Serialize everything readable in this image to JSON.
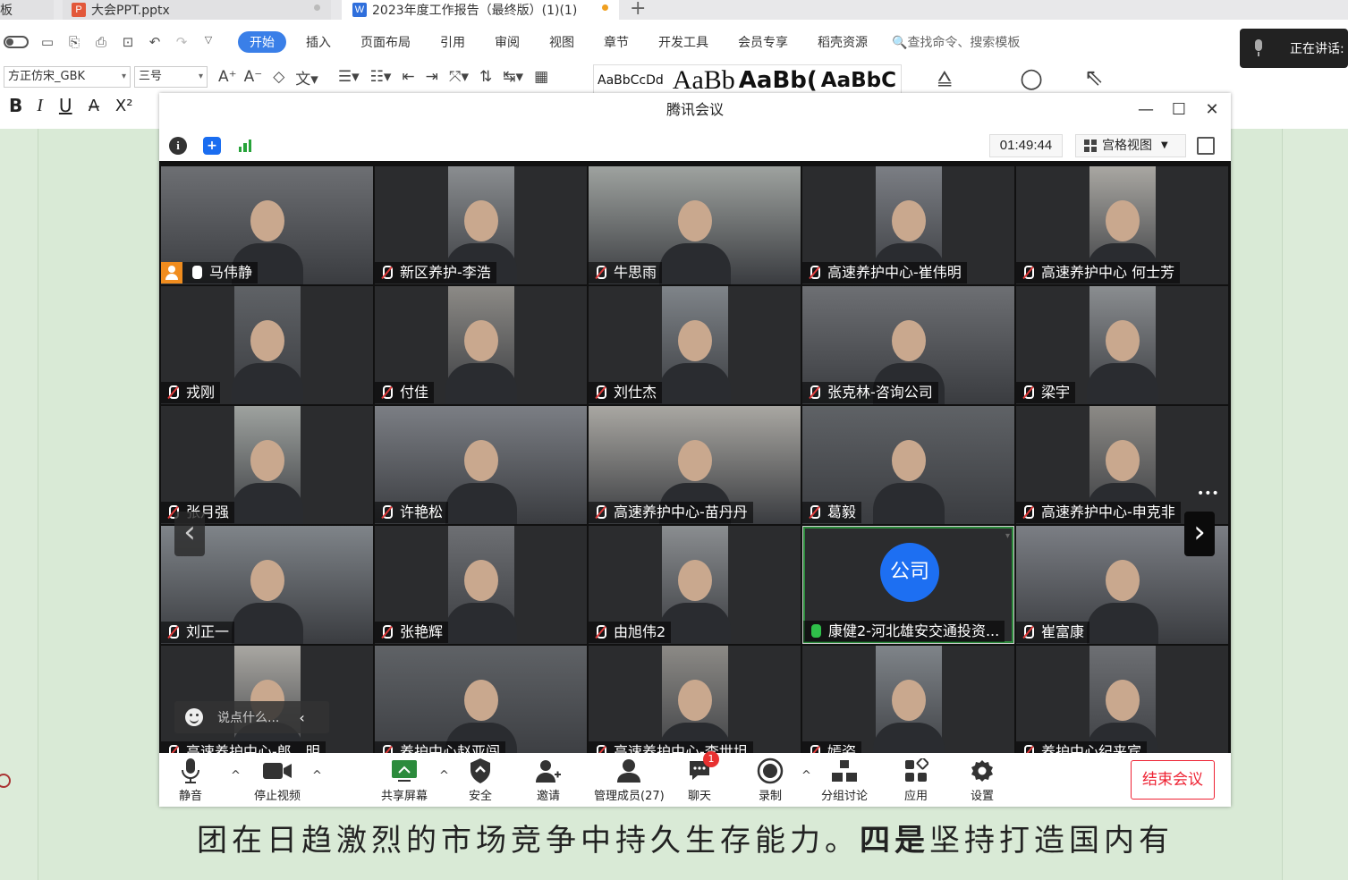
{
  "tabs": [
    {
      "label": "稿板"
    },
    {
      "label": "大会PPT.pptx",
      "icon": "P"
    },
    {
      "label": "2023年度工作报告（最终版）(1)(1)",
      "icon": "W"
    }
  ],
  "ribbon": {
    "menus": [
      "开始",
      "插入",
      "页面布局",
      "引用",
      "审阅",
      "视图",
      "章节",
      "开发工具",
      "会员专享",
      "稻壳资源"
    ],
    "search": "查找命令、搜索模板",
    "font_name": "方正仿宋_GBK",
    "font_size": "三号",
    "style_samples": [
      "AaBbCcDd",
      "AaBb",
      "AaBb(",
      "AaBbC"
    ]
  },
  "speaking_label": "正在讲话:",
  "meeting": {
    "title": "腾讯会议",
    "timer": "01:49:44",
    "view_mode": "宫格视图",
    "chat_placeholder": "说点什么...",
    "end_button": "结束会议",
    "accent": "#1d6ff2",
    "participants": [
      {
        "name": "马伟静",
        "host": true
      },
      {
        "name": "新区养护-李浩"
      },
      {
        "name": "牛思雨"
      },
      {
        "name": "高速养护中心-崔伟明"
      },
      {
        "name": "高速养护中心 何士芳"
      },
      {
        "name": "戎刚"
      },
      {
        "name": "付佳"
      },
      {
        "name": "刘仕杰"
      },
      {
        "name": "张克林-咨询公司"
      },
      {
        "name": "梁宇"
      },
      {
        "name": "张月强"
      },
      {
        "name": "许艳松"
      },
      {
        "name": "高速养护中心-苗丹丹"
      },
      {
        "name": "葛毅"
      },
      {
        "name": "高速养护中心-申克非"
      },
      {
        "name": "刘正一"
      },
      {
        "name": "张艳辉"
      },
      {
        "name": "由旭伟2"
      },
      {
        "name": "康健2-河北雄安交通投资...",
        "avatar": "公司",
        "mic_on": true
      },
      {
        "name": "崔富康"
      },
      {
        "name": "高速养护中心-郎…明"
      },
      {
        "name": "养护中心赵亚闯"
      },
      {
        "name": "高速养护中心-李世坦"
      },
      {
        "name": "嫣姿"
      },
      {
        "name": "养护中心纪来宾"
      }
    ],
    "toolbar": [
      {
        "label": "静音",
        "icon": "mic-icon"
      },
      {
        "label": "停止视频",
        "icon": "camera-icon"
      },
      {
        "label": "共享屏幕",
        "icon": "share-screen-icon"
      },
      {
        "label": "安全",
        "icon": "shield-icon"
      },
      {
        "label": "邀请",
        "icon": "invite-icon"
      },
      {
        "label": "管理成员(27)",
        "icon": "members-icon"
      },
      {
        "label": "聊天",
        "icon": "chat-icon",
        "badge": "1"
      },
      {
        "label": "录制",
        "icon": "record-icon"
      },
      {
        "label": "分组讨论",
        "icon": "breakout-icon"
      },
      {
        "label": "应用",
        "icon": "apps-icon"
      },
      {
        "label": "设置",
        "icon": "gear-icon"
      }
    ]
  },
  "document_text": {
    "part1": "团在日趋激烈的市场竞争中持久生存能力。",
    "bold": "四是",
    "part2": "坚持打造国内有"
  }
}
